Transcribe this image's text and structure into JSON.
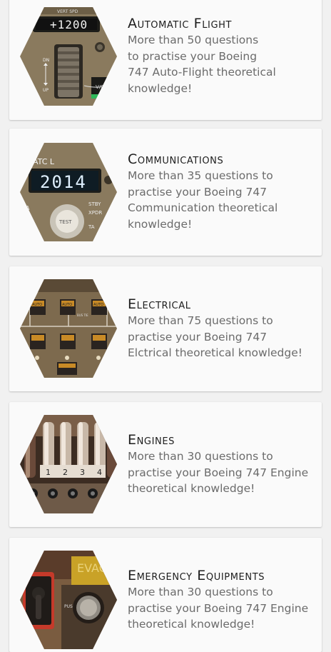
{
  "modules": [
    {
      "title": "Automatic Flight",
      "description_lines": [
        "More than 50 questions",
        "to practise your Boeing",
        "747 Auto-Flight theoretical",
        "knowledge!"
      ],
      "panel_text": [
        "VERT SPD",
        "+1200",
        "DN",
        "UP",
        "V/S"
      ]
    },
    {
      "title": "Communications",
      "description_lines": [
        "More than 35 questions to",
        "practise your Boeing 747",
        "Communication theoretical",
        "knowledge!"
      ],
      "panel_text": [
        "ATC L",
        "2014",
        "STBY",
        "XPDR",
        "TA",
        "TEST",
        "A"
      ]
    },
    {
      "title": "Electrical",
      "description_lines": [
        "More than 75 questions to",
        "practise your Boeing 747",
        "Elctrical theoretical knowledge!"
      ],
      "panel_text": [
        "AUTO",
        "AUTO",
        "BUS TIE",
        "AUTO"
      ]
    },
    {
      "title": "Engines",
      "description_lines": [
        "More than 30 questions to",
        "practise your Boeing 747 Engine",
        "theoretical knowledge!"
      ],
      "panel_text": [
        "1",
        "2",
        "3",
        "4"
      ]
    },
    {
      "title": "Emergency Equipments",
      "description_lines": [
        "More than 30 questions to",
        "practise your Boeing 747 Engine",
        "theoretical knowledge!"
      ],
      "panel_text": [
        "EVAC",
        "PUSH"
      ]
    }
  ],
  "colors": {
    "background": "#f1f1f1",
    "card": "#fafafa",
    "title": "#1d1d1d",
    "description": "#6b6b6b",
    "panel_beige": "#8c7a5e",
    "panel_brown": "#4a3a2a",
    "display_green": "#2a3a26",
    "evac_yellow": "#c9a227"
  },
  "icons": [
    "autoflight-panel-icon",
    "communications-panel-icon",
    "electrical-panel-icon",
    "engines-throttle-icon",
    "emergency-panel-icon"
  ]
}
